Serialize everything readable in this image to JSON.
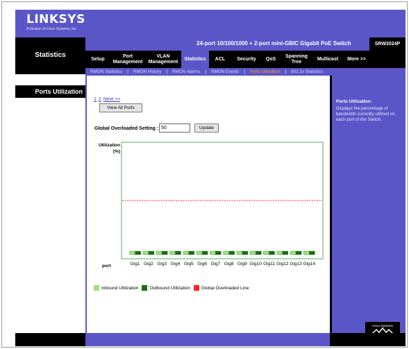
{
  "brand": {
    "logo": "LINKSYS",
    "tagline": "A Division of Cisco Systems, Inc."
  },
  "section_title": "Statistics",
  "product": {
    "name": "24-port 10/100/1000 + 2-port mini-GBIC Gigabit PoE Switch",
    "model": "SRW2024P"
  },
  "main_nav": [
    {
      "label": "Setup",
      "active": false
    },
    {
      "label": "Port\nManagement",
      "active": false
    },
    {
      "label": "VLAN\nManagement",
      "active": false
    },
    {
      "label": "Statistics",
      "active": true
    },
    {
      "label": "ACL",
      "active": false
    },
    {
      "label": "Security",
      "active": false
    },
    {
      "label": "QoS",
      "active": false
    },
    {
      "label": "Spanning\nTree",
      "active": false
    },
    {
      "label": "Multicast",
      "active": false
    },
    {
      "label": "More >>",
      "active": false
    }
  ],
  "sub_nav": [
    {
      "label": "RMON Statistics",
      "active": false
    },
    {
      "label": "RMON History",
      "active": false
    },
    {
      "label": "RMON Alarms",
      "active": false
    },
    {
      "label": "RMON Events",
      "active": false
    },
    {
      "label": "Ports Utilization",
      "active": true
    },
    {
      "label": "802.1x Statistics",
      "active": false
    }
  ],
  "left_title": "Ports Utilization",
  "pager": {
    "page1": "1",
    "page2": "2",
    "next": "Next >>",
    "view_all": "View All Ports"
  },
  "overload": {
    "label": "Global Overloaded Setting :",
    "value": "50",
    "button": "Update"
  },
  "chart_data": {
    "type": "bar",
    "ylabel": "Utilization (%)",
    "xlabel": "port",
    "ylim": [
      0,
      100
    ],
    "categories": [
      "Gig1",
      "Gig2",
      "Gig3",
      "Gig4",
      "Gig5",
      "Gig6",
      "Gig7",
      "Gig8",
      "Gig9",
      "Gig10",
      "Gig11",
      "Gig12",
      "Gig13",
      "Gig14"
    ],
    "series": [
      {
        "name": "Inbound Utilization",
        "color": "#a3e07a",
        "values": [
          0,
          0,
          0,
          0,
          0,
          0,
          0,
          0,
          0,
          0,
          0,
          0,
          0,
          0
        ]
      },
      {
        "name": "Outbound Utilization",
        "color": "#1a6b1a",
        "values": [
          0,
          0,
          0,
          0,
          0,
          0,
          0,
          0,
          0,
          0,
          0,
          0,
          0,
          0
        ]
      }
    ],
    "overload_line": {
      "name": "Global Overloaded Line",
      "value": 50,
      "color": "#ff2020"
    }
  },
  "legend": {
    "inbound": "Inbound Utilization",
    "outbound": "Outbound Utilization",
    "overload": "Global Overloaded Line"
  },
  "help": {
    "title": "Ports Utilization:",
    "text": "Displays the percentage of bandwidth currently utilized on each port of the Switch."
  },
  "cisco_logo_text": "Cisco Systems",
  "colors": {
    "brand_purple": "#5a56c8",
    "active_sub": "#ffa200",
    "chart_border": "#7ab87a"
  }
}
